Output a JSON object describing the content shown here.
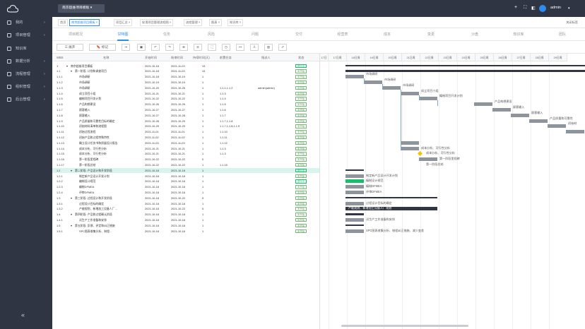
{
  "sidebar": {
    "items": [
      {
        "label": "我的",
        "icon": "user-icon"
      },
      {
        "label": "项目管理",
        "icon": "folder-icon"
      },
      {
        "label": "知识库",
        "icon": "book-icon"
      },
      {
        "label": "数据分析",
        "icon": "chart-icon"
      },
      {
        "label": "流程管理",
        "icon": "flow-icon"
      },
      {
        "label": "组织管理",
        "icon": "org-icon"
      },
      {
        "label": "后台管理",
        "icon": "gear-icon"
      }
    ],
    "collapse": "«"
  },
  "topbar": {
    "project": "南京超维项目模板",
    "user": "admin"
  },
  "page_tabs": [
    {
      "label": "首页",
      "closable": false
    },
    {
      "label": "南京超维项目模板",
      "closable": true
    },
    {
      "label": "项目汇总",
      "closable": true
    },
    {
      "label": "轮滑项目管理流程图",
      "closable": true
    },
    {
      "label": "流程管理",
      "closable": true
    },
    {
      "label": "图表",
      "closable": true
    },
    {
      "label": "知识库",
      "closable": true
    }
  ],
  "tab_right": "关闭标签",
  "sub_tabs": [
    "项目概况",
    "甘特图",
    "任务",
    "风险",
    "问题",
    "交付",
    "经营表",
    "成本",
    "变更",
    "沙盘",
    "知识库",
    "团队"
  ],
  "toolbar": {
    "view_btn": "☰ 展开",
    "mark_btn": "🔖 标记"
  },
  "grid": {
    "headers": [
      "WBS",
      "名称",
      "开始时间",
      "结束时间",
      "持续时间(天)",
      "前置任务",
      "指派人",
      "状态"
    ],
    "rows": [
      {
        "wbs": "1",
        "name": "南京超维项目模板",
        "start": "2021-10-18",
        "end": "2021-11-03",
        "dur": "13",
        "pre": "",
        "who": "",
        "status": "进行中",
        "indent": 0,
        "exp": "▾"
      },
      {
        "wbs": "1.1",
        "name": "第一阶段: 计划和调查项目",
        "start": "2021-10-18",
        "end": "2021-11-03",
        "dur": "13",
        "pre": "",
        "who": "",
        "status": "未开始",
        "indent": 1,
        "exp": "▾"
      },
      {
        "wbs": "1.1.1",
        "name": "市场调研",
        "start": "2021-10-18",
        "end": "2021-10-19",
        "dur": "1",
        "pre": "",
        "who": "",
        "status": "未开始",
        "indent": 2,
        "exp": ""
      },
      {
        "wbs": "1.1.2",
        "name": "市场调研",
        "start": "2021-10-19",
        "end": "2021-10-19",
        "dur": "1",
        "pre": "",
        "who": "",
        "status": "未开始",
        "indent": 2,
        "exp": ""
      },
      {
        "wbs": "1.1.3",
        "name": "市场调研",
        "start": "2021-10-20",
        "end": "2021-10-26",
        "dur": "1",
        "pre": "1.1.1,1.1.2",
        "who": "admin(admin)",
        "status": "未开始",
        "indent": 2,
        "exp": ""
      },
      {
        "wbs": "1.1.4",
        "name": "成立项目小组",
        "start": "2021-10-21",
        "end": "2021-10-21",
        "dur": "1",
        "pre": "1.1.3",
        "who": "",
        "status": "未开始",
        "indent": 2,
        "exp": ""
      },
      {
        "wbs": "1.1.5",
        "name": "编制项目开发计划",
        "start": "2021-10-22",
        "end": "2021-10-22",
        "dur": "1",
        "pre": "1.1.4",
        "who": "",
        "status": "未开始",
        "indent": 2,
        "exp": ""
      },
      {
        "wbs": "1.1.6",
        "name": "产品构想建设",
        "start": "2021-10-26",
        "end": "2021-10-26",
        "dur": "1",
        "pre": "1.1.5",
        "who": "",
        "status": "未开始",
        "indent": 2,
        "exp": ""
      },
      {
        "wbs": "1.1.7",
        "name": "顾客输入",
        "start": "2021-10-27",
        "end": "2021-10-27",
        "dur": "1",
        "pre": "1.1.6",
        "who": "",
        "status": "未开始",
        "indent": 2,
        "exp": ""
      },
      {
        "wbs": "1.1.8",
        "name": "顾客输入",
        "start": "2021-10-27",
        "end": "2021-10-28",
        "dur": "1",
        "pre": "1.1.7",
        "who": "",
        "status": "未开始",
        "indent": 2,
        "exp": ""
      },
      {
        "wbs": "1.1.9",
        "name": "产品质量和可靠性目标的确定",
        "start": "2021-10-28",
        "end": "2021-10-29",
        "dur": "1",
        "pre": "1.1.7,1.1.8",
        "who": "",
        "status": "未开始",
        "indent": 2,
        "exp": ""
      },
      {
        "wbs": "1.1.10",
        "name": "初始材料清单和流程图",
        "start": "2021-10-29",
        "end": "2021-10-29",
        "dur": "1",
        "pre": "1.1.7,1.1.8,1.1.9",
        "who": "",
        "status": "未开始",
        "indent": 2,
        "exp": ""
      },
      {
        "wbs": "1.1.11",
        "name": "初始过程流程",
        "start": "2021-11-01",
        "end": "2021-11-01",
        "dur": "1",
        "pre": "1.1.10",
        "who": "",
        "status": "未开始",
        "indent": 2,
        "exp": ""
      },
      {
        "wbs": "1.1.12",
        "name": "初始产品和过程特殊特性",
        "start": "2021-11-02",
        "end": "2021-11-02",
        "dur": "1",
        "pre": "1.1.11",
        "who": "",
        "status": "未开始",
        "indent": 2,
        "exp": ""
      },
      {
        "wbs": "1.1.13",
        "name": "确立设计任务书和质量设计报告",
        "start": "2021-11-03",
        "end": "2021-11-03",
        "dur": "1",
        "pre": "1.1.12",
        "who": "",
        "status": "未开始",
        "indent": 2,
        "exp": ""
      },
      {
        "wbs": "1.1.14",
        "name": "成本分析、可行性分析",
        "start": "2021-10-21",
        "end": "2021-10-21",
        "dur": "1",
        "pre": "1.1.3",
        "who": "",
        "status": "未开始",
        "indent": 2,
        "exp": ""
      },
      {
        "wbs": "1.1.15",
        "name": "成本分析、可行性分析",
        "start": "2021-10-21",
        "end": "2021-10-21",
        "dur": "1",
        "pre": "1.1.3",
        "who": "",
        "status": "未开始",
        "indent": 2,
        "exp": ""
      },
      {
        "wbs": "1.1.16",
        "name": "第一阶段里程碑",
        "start": "2021-10-22",
        "end": "2021-10-22",
        "dur": "0",
        "pre": "",
        "who": "",
        "status": "未开始",
        "indent": 2,
        "exp": ""
      },
      {
        "wbs": "1.1.17",
        "name": "第一阶段总结",
        "start": "2021-10-22",
        "end": "2021-10-22",
        "dur": "1",
        "pre": "1.1.15",
        "who": "",
        "status": "未开始",
        "indent": 2,
        "exp": ""
      },
      {
        "wbs": "1.2",
        "name": "第二阶段: 产品设计和开发阶段",
        "start": "2021-10-18",
        "end": "2021-10-18",
        "dur": "1",
        "pre": "",
        "who": "",
        "status": "进行中",
        "indent": 1,
        "exp": "▾"
      },
      {
        "wbs": "1.2.1",
        "name": "制定新产品设计开发计划",
        "start": "2021-10-18",
        "end": "2021-10-18",
        "dur": "1",
        "pre": "",
        "who": "",
        "status": "未开始",
        "indent": 2,
        "exp": ""
      },
      {
        "wbs": "1.2.2",
        "name": "编制设计规范",
        "start": "2021-10-18",
        "end": "2021-10-18",
        "dur": "1",
        "pre": "",
        "who": "",
        "status": "进行中",
        "indent": 2,
        "exp": ""
      },
      {
        "wbs": "1.2.3",
        "name": "编制DFMEA",
        "start": "2021-10-18",
        "end": "2021-10-18",
        "dur": "1",
        "pre": "",
        "who": "",
        "status": "未开始",
        "indent": 2,
        "exp": ""
      },
      {
        "wbs": "1.2.4",
        "name": "评审DFMEA",
        "start": "2021-10-18",
        "end": "2021-10-18",
        "dur": "1",
        "pre": "",
        "who": "",
        "status": "未开始",
        "indent": 2,
        "exp": ""
      },
      {
        "wbs": "1.3",
        "name": "第三阶段: 过程设计和开发阶段",
        "start": "2021-10-18",
        "end": "2021-10-22",
        "dur": "5",
        "pre": "",
        "who": "",
        "status": "未开始",
        "indent": 1,
        "exp": "▾"
      },
      {
        "wbs": "1.3.1",
        "name": "过程设计目标的确定",
        "start": "2021-10-18",
        "end": "2021-10-18",
        "dur": "1",
        "pre": "",
        "who": "",
        "status": "未开始",
        "indent": 2,
        "exp": ""
      },
      {
        "wbs": "1.3.2",
        "name": "产能规划、新增加工设备人厂...",
        "start": "2021-10-18",
        "end": "2021-10-22",
        "dur": "5",
        "pre": "",
        "who": "",
        "status": "未开始",
        "indent": 2,
        "exp": ""
      },
      {
        "wbs": "1.4",
        "name": "第四阶段: 产品和过程确认阶段",
        "start": "2021-10-18",
        "end": "2021-10-18",
        "dur": "1",
        "pre": "",
        "who": "",
        "status": "未开始",
        "indent": 1,
        "exp": "▾"
      },
      {
        "wbs": "1.4.1",
        "name": "试生产工作准备和安排",
        "start": "2021-10-18",
        "end": "2021-10-18",
        "dur": "1",
        "pre": "",
        "who": "",
        "status": "未开始",
        "indent": 2,
        "exp": ""
      },
      {
        "wbs": "1.5",
        "name": "第五阶段: 反馈、评定和纠正措施",
        "start": "2021-10-18",
        "end": "2021-10-18",
        "dur": "1",
        "pre": "",
        "who": "",
        "status": "未开始",
        "indent": 1,
        "exp": "▾"
      },
      {
        "wbs": "1.5.1",
        "name": "SPC图表收集分析、制程...",
        "start": "2021-10-18",
        "end": "2021-10-18",
        "dur": "1",
        "pre": "",
        "who": "",
        "status": "未开始",
        "indent": 2,
        "exp": ""
      }
    ]
  },
  "gantt": {
    "days": [
      "17日",
      "17日周",
      "18日周",
      "19日周",
      "20日周",
      "21日周",
      "22日周",
      "23日周",
      "24日周",
      "25日周",
      "26日周",
      "27日周",
      "28日周",
      "29日周"
    ],
    "bar_labels": [
      {
        "row": 2,
        "text": "市场调研"
      },
      {
        "row": 3,
        "text": "市场调研"
      },
      {
        "row": 4,
        "text": "市场调研"
      },
      {
        "row": 5,
        "text": "成立项目小组"
      },
      {
        "row": 6,
        "text": "编制项目开发计划"
      },
      {
        "row": 7,
        "text": "产品构想建设"
      },
      {
        "row": 8,
        "text": "顾客输入"
      },
      {
        "row": 9,
        "text": "顾客输入"
      },
      {
        "row": 10,
        "text": "产品质量和可靠性"
      },
      {
        "row": 11,
        "text": "初始材"
      },
      {
        "row": 12,
        "text": "初"
      },
      {
        "row": 15,
        "text": "成本分析、可行性分析"
      },
      {
        "row": 16,
        "text": "成本分析、可行性分析"
      },
      {
        "row": 17,
        "text": "第一阶段里程碑"
      },
      {
        "row": 18,
        "text": "第一阶段总结"
      },
      {
        "row": 20,
        "text": "制定新产品设计开发计划"
      },
      {
        "row": 21,
        "text": "编制设计规范"
      },
      {
        "row": 22,
        "text": "编制DFMEA"
      },
      {
        "row": 23,
        "text": "评审DFMEA"
      },
      {
        "row": 25,
        "text": "过程设计目标的确定"
      },
      {
        "row": 26,
        "text": "产能规划、新增加工设备人厂规划"
      },
      {
        "row": 28,
        "text": "试生产工作准备和安排"
      },
      {
        "row": 30,
        "text": "SPC图表收集分析、制程纠正措施、减少变差"
      }
    ]
  }
}
